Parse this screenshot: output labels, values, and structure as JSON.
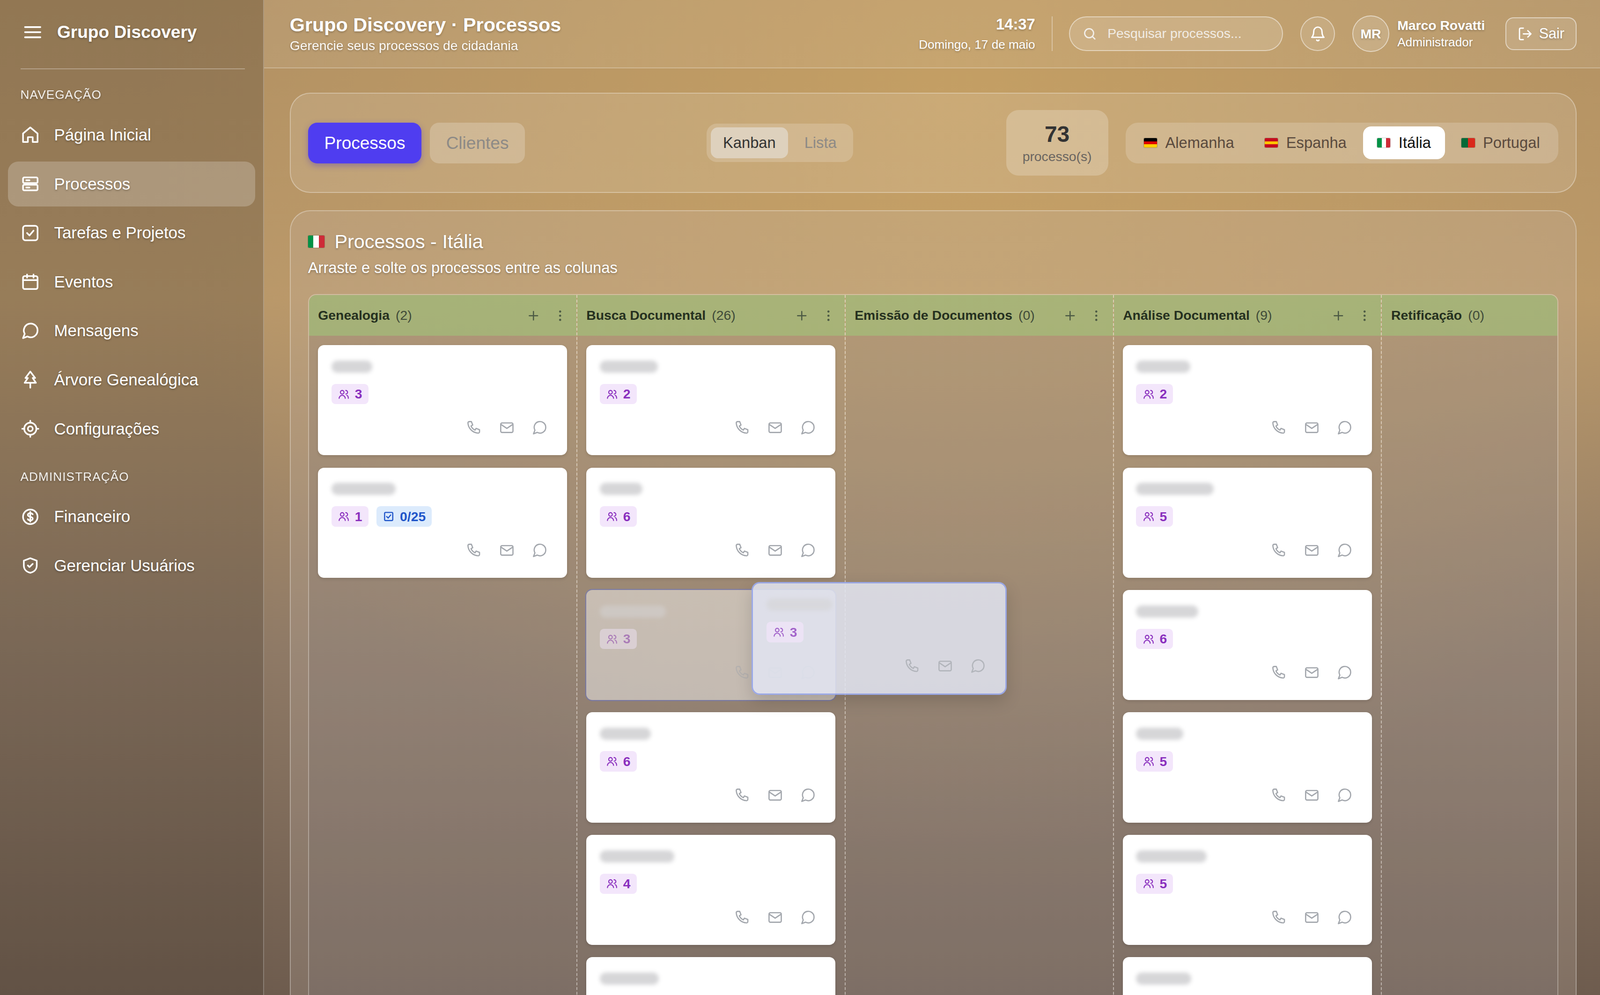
{
  "sidebar": {
    "brand": "Grupo Discovery",
    "sections": [
      {
        "title": "NAVEGAÇÃO",
        "items": [
          {
            "label": "Página Inicial",
            "selected": false
          },
          {
            "label": "Processos",
            "selected": true
          },
          {
            "label": "Tarefas e Projetos",
            "selected": false
          },
          {
            "label": "Eventos",
            "selected": false
          },
          {
            "label": "Mensagens",
            "selected": false
          },
          {
            "label": "Árvore Genealógica",
            "selected": false
          },
          {
            "label": "Configurações",
            "selected": false
          }
        ]
      },
      {
        "title": "ADMINISTRAÇÃO",
        "items": [
          {
            "label": "Financeiro",
            "selected": false
          },
          {
            "label": "Gerenciar Usuários",
            "selected": false
          }
        ]
      }
    ]
  },
  "header": {
    "title": "Grupo Discovery · Processos",
    "subtitle": "Gerencie seus processos de cidadania",
    "time": "14:37",
    "date": "Domingo, 17 de maio",
    "search": {
      "placeholder": "Pesquisar processos..."
    },
    "user": {
      "initials": "MR",
      "name": "Marco Rovatti",
      "role": "Administrador"
    },
    "logout": "Sair"
  },
  "tabs": [
    {
      "label": "Processos",
      "selected": true
    },
    {
      "label": "Clientes",
      "selected": false
    }
  ],
  "views": [
    {
      "label": "Kanban",
      "selected": true
    },
    {
      "label": "Lista",
      "selected": false
    }
  ],
  "total": {
    "count": "73",
    "label": "processo(s)"
  },
  "countries": [
    {
      "label": "Alemanha",
      "selected": false,
      "flag": {
        "stripes": "horizontal",
        "colors": [
          "#000000",
          "#dd0000",
          "#ffce00"
        ]
      }
    },
    {
      "label": "Espanha",
      "selected": false,
      "flag": {
        "stripes": "horizontal",
        "colors": [
          "#c60b1e",
          "#ffc400",
          "#c60b1e"
        ]
      }
    },
    {
      "label": "Itália",
      "selected": true,
      "flag": {
        "stripes": "vertical",
        "colors": [
          "#009246",
          "#ffffff",
          "#ce2b37"
        ]
      }
    },
    {
      "label": "Portugal",
      "selected": false,
      "flag": {
        "stripes": "vertical",
        "colors": [
          "#046a38",
          "#da291c"
        ]
      }
    }
  ],
  "board": {
    "title": "Processos - Itália",
    "flag": {
      "stripes": "vertical",
      "colors": [
        "#009246",
        "#ffffff",
        "#ce2b37"
      ]
    },
    "subtitle": "Arraste e solte os processos entre as colunas",
    "columns": [
      {
        "title": "Genealogia",
        "count": "(2)",
        "actions": true,
        "cards": [
          {
            "people": "3",
            "tasks": null,
            "dragging": false
          },
          {
            "people": "1",
            "tasks": "0/25",
            "dragging": false
          }
        ]
      },
      {
        "title": "Busca Documental",
        "count": "(26)",
        "actions": true,
        "cards": [
          {
            "people": "2",
            "tasks": null,
            "dragging": false
          },
          {
            "people": "6",
            "tasks": null,
            "dragging": false
          },
          {
            "people": "3",
            "tasks": null,
            "dragging": true
          },
          {
            "people": "6",
            "tasks": null,
            "dragging": false
          },
          {
            "people": "4",
            "tasks": null,
            "dragging": false
          },
          {
            "people": null,
            "tasks": null,
            "dragging": false
          }
        ]
      },
      {
        "title": "Emissão de Documentos",
        "count": "(0)",
        "actions": true,
        "cards": []
      },
      {
        "title": "Análise Documental",
        "count": "(9)",
        "actions": true,
        "cards": [
          {
            "people": "2",
            "tasks": null,
            "dragging": false
          },
          {
            "people": "5",
            "tasks": null,
            "dragging": false
          },
          {
            "people": "6",
            "tasks": null,
            "dragging": false
          },
          {
            "people": "5",
            "tasks": null,
            "dragging": false
          },
          {
            "people": "5",
            "tasks": null,
            "dragging": false
          },
          {
            "people": null,
            "tasks": null,
            "dragging": false
          }
        ]
      },
      {
        "title": "Retificação",
        "count": "(0)",
        "actions": false,
        "cards": []
      }
    ]
  }
}
